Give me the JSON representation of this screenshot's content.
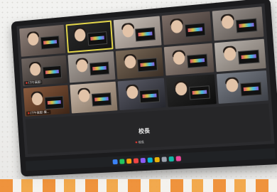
{
  "participants": [
    {
      "label": "",
      "tile": "t1"
    },
    {
      "label": "",
      "tile": "t2",
      "active": true
    },
    {
      "label": "",
      "tile": "t3"
    },
    {
      "label": "",
      "tile": "t4"
    },
    {
      "label": "",
      "tile": "t5"
    },
    {
      "label": "(下午高班)",
      "tile": "t6"
    },
    {
      "label": "",
      "tile": "t7"
    },
    {
      "label": "",
      "tile": "t8"
    },
    {
      "label": "",
      "tile": "t9"
    },
    {
      "label": "",
      "tile": "t10"
    },
    {
      "label": "(下午高班) 陳...",
      "tile": "t11"
    },
    {
      "label": "",
      "tile": "t12"
    },
    {
      "label": "",
      "tile": "t13"
    },
    {
      "label": "",
      "tile": "t14"
    },
    {
      "label": "",
      "tile": "t15"
    }
  ],
  "main_speaker": {
    "name": "校長",
    "tag": "校長"
  },
  "colors": {
    "active_outline": "#e6d84a",
    "mic_muted": "#ff3b30",
    "strip_orange": "#f08a2a"
  },
  "taskbar_icons": [
    "blue",
    "green",
    "orange",
    "red",
    "purple",
    "cyan",
    "yellow",
    "gray",
    "teal",
    "pink"
  ]
}
